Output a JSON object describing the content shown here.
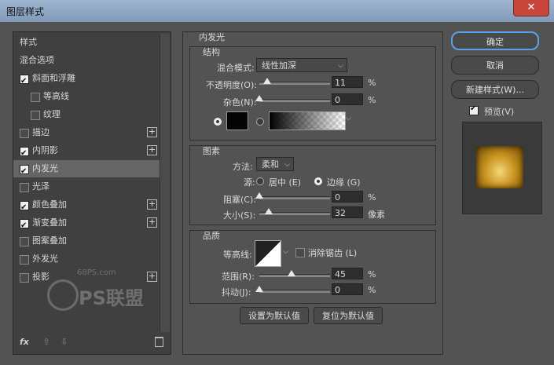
{
  "window": {
    "title": "图层样式",
    "close_glyph": "✕"
  },
  "left_panel": {
    "items": [
      {
        "label": "样式",
        "checkbox": null,
        "plus": false,
        "selected": false
      },
      {
        "label": "混合选项",
        "checkbox": null,
        "plus": false,
        "selected": false
      },
      {
        "label": "斜面和浮雕",
        "checkbox": true,
        "plus": false,
        "selected": false
      },
      {
        "label": "等高线",
        "checkbox": false,
        "plus": false,
        "selected": false,
        "indent": true
      },
      {
        "label": "纹理",
        "checkbox": false,
        "plus": false,
        "selected": false,
        "indent": true
      },
      {
        "label": "描边",
        "checkbox": false,
        "plus": true,
        "selected": false
      },
      {
        "label": "内阴影",
        "checkbox": true,
        "plus": true,
        "selected": false
      },
      {
        "label": "内发光",
        "checkbox": true,
        "plus": false,
        "selected": true
      },
      {
        "label": "光泽",
        "checkbox": false,
        "plus": false,
        "selected": false
      },
      {
        "label": "颜色叠加",
        "checkbox": true,
        "plus": true,
        "selected": false
      },
      {
        "label": "渐变叠加",
        "checkbox": true,
        "plus": true,
        "selected": false
      },
      {
        "label": "图案叠加",
        "checkbox": false,
        "plus": false,
        "selected": false
      },
      {
        "label": "外发光",
        "checkbox": false,
        "plus": false,
        "selected": false
      },
      {
        "label": "投影",
        "checkbox": false,
        "plus": true,
        "selected": false
      }
    ],
    "bottom": {
      "fx": "fx",
      "up": "⇧",
      "down": "⇩",
      "trash": "🗑"
    }
  },
  "panel": {
    "title": "内发光",
    "structure": {
      "title": "结构",
      "blend_mode_label": "混合模式:",
      "blend_mode_value": "线性加深",
      "opacity_label": "不透明度(O):",
      "opacity_value": "11",
      "opacity_fraction": 0.11,
      "noise_label": "杂色(N):",
      "noise_value": "0",
      "noise_fraction": 0.0,
      "pct": "%"
    },
    "elements": {
      "title": "图素",
      "method_label": "方法:",
      "method_value": "柔和",
      "source_label": "源:",
      "source_center": "居中 (E)",
      "source_edge": "边缘 (G)",
      "choke_label": "阻塞(C):",
      "choke_value": "0",
      "choke_fraction": 0.0,
      "size_label": "大小(S):",
      "size_value": "32",
      "size_fraction": 0.13,
      "pct": "%",
      "px_unit": "像素"
    },
    "quality": {
      "title": "品质",
      "contour_label": "等高线:",
      "antialias_label": "消除锯齿 (L)",
      "range_label": "范围(R):",
      "range_value": "45",
      "range_fraction": 0.45,
      "jitter_label": "抖动(J):",
      "jitter_value": "0",
      "jitter_fraction": 0.0,
      "pct": "%"
    },
    "buttons": {
      "make_default": "设置为默认值",
      "reset_default": "复位为默认值"
    }
  },
  "right": {
    "ok": "确定",
    "cancel": "取消",
    "new_style": "新建样式(W)...",
    "preview_label": "预览(V)"
  },
  "watermark": {
    "site": "68PS.com",
    "logo_text": "PS联盟"
  }
}
